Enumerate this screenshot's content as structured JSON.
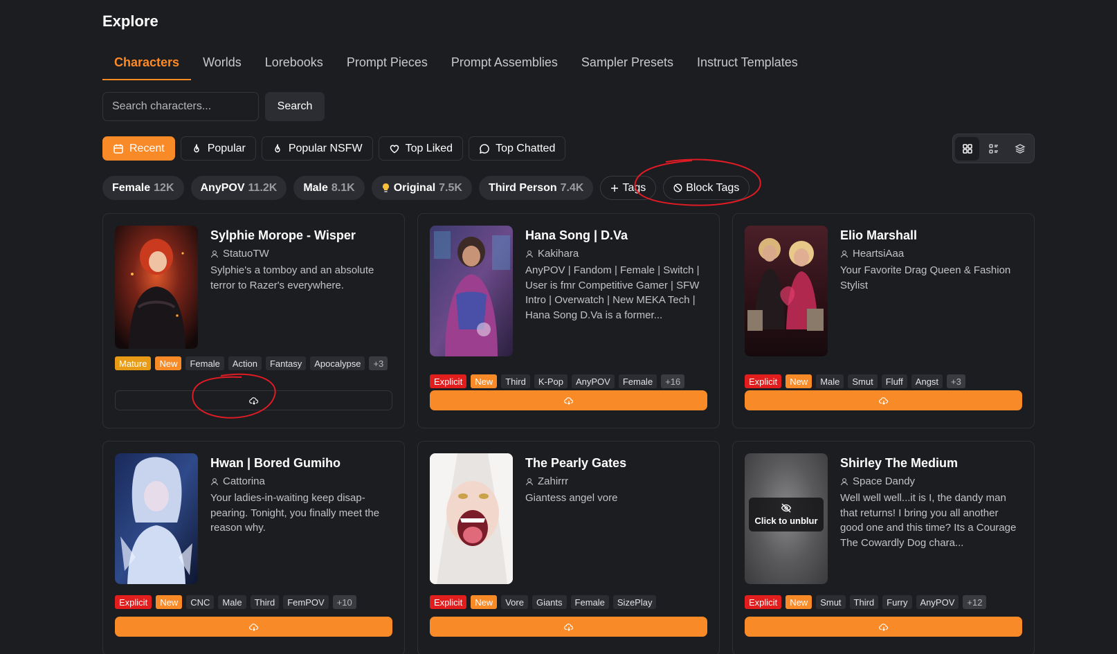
{
  "page": {
    "title": "Explore"
  },
  "tabs": [
    {
      "label": "Characters",
      "active": true
    },
    {
      "label": "Worlds"
    },
    {
      "label": "Lorebooks"
    },
    {
      "label": "Prompt Pieces"
    },
    {
      "label": "Prompt Assemblies"
    },
    {
      "label": "Sampler Presets"
    },
    {
      "label": "Instruct Templates"
    }
  ],
  "search": {
    "placeholder": "Search characters...",
    "value": "",
    "button_label": "Search"
  },
  "sorts": [
    {
      "label": "Recent",
      "icon": "calendar-icon",
      "active": true
    },
    {
      "label": "Popular",
      "icon": "flame-icon"
    },
    {
      "label": "Popular NSFW",
      "icon": "flame-icon"
    },
    {
      "label": "Top Liked",
      "icon": "heart-icon"
    },
    {
      "label": "Top Chatted",
      "icon": "chat-bubble-icon"
    }
  ],
  "views": [
    "grid-view-icon",
    "list-view-icon",
    "layers-view-icon"
  ],
  "tag_filters": [
    {
      "label": "Female",
      "count": "12K"
    },
    {
      "label": "AnyPOV",
      "count": "11.2K"
    },
    {
      "label": "Male",
      "count": "8.1K"
    },
    {
      "label": "Original",
      "count": "7.5K",
      "icon": "lightbulb-icon"
    },
    {
      "label": "Third Person",
      "count": "7.4K"
    }
  ],
  "tag_buttons": {
    "add_label": "Tags",
    "block_label": "Block Tags"
  },
  "colors": {
    "accent": "#f98a28",
    "background": "#1c1d21",
    "explicit": "#e11d1d",
    "mature": "#e89b16",
    "annotation": "#e01b24"
  },
  "cards": [
    {
      "name": "Sylphie Morope - Wisper",
      "author": "StatuoTW",
      "description": "Sylphie's a tomboy and an absolute terror to Razer's everywhere.",
      "tags": [
        {
          "label": "Mature",
          "kind": "mature"
        },
        {
          "label": "New",
          "kind": "new"
        },
        {
          "label": "Female"
        },
        {
          "label": "Action"
        },
        {
          "label": "Fantasy"
        },
        {
          "label": "Apocalypse"
        },
        {
          "label": "+3",
          "kind": "more"
        }
      ],
      "download_style": "ghost"
    },
    {
      "name": "Hana Song | D.Va",
      "author": "Kakihara",
      "description": "AnyPOV | Fandom | Female | Switch | User is fmr Competitive Gamer | SFW Intro | Overwatch | New MEKA Tech | Hana Song D.Va is a former...",
      "tags": [
        {
          "label": "Explicit",
          "kind": "explicit"
        },
        {
          "label": "New",
          "kind": "new"
        },
        {
          "label": "Third"
        },
        {
          "label": "K-Pop"
        },
        {
          "label": "AnyPOV"
        },
        {
          "label": "Female"
        },
        {
          "label": "+16",
          "kind": "more"
        }
      ]
    },
    {
      "name": "Elio Marshall",
      "author": "HeartsiAaa",
      "description": "Your Favorite Drag Queen & Fashion Stylist",
      "tags": [
        {
          "label": "Explicit",
          "kind": "explicit"
        },
        {
          "label": "New",
          "kind": "new"
        },
        {
          "label": "Male"
        },
        {
          "label": "Smut"
        },
        {
          "label": "Fluff"
        },
        {
          "label": "Angst"
        },
        {
          "label": "+3",
          "kind": "more"
        }
      ]
    },
    {
      "name": "Hwan | Bored Gumiho",
      "author": "Cattorina",
      "description": "Your ladies-in-waiting keep disap-pearing. Tonight, you finally meet the reason why.",
      "tags": [
        {
          "label": "Explicit",
          "kind": "explicit"
        },
        {
          "label": "New",
          "kind": "new"
        },
        {
          "label": "CNC"
        },
        {
          "label": "Male"
        },
        {
          "label": "Third"
        },
        {
          "label": "FemPOV"
        },
        {
          "label": "+10",
          "kind": "more"
        }
      ]
    },
    {
      "name": "The Pearly Gates",
      "author": "Zahirrr",
      "description": "Giantess angel vore",
      "tags": [
        {
          "label": "Explicit",
          "kind": "explicit"
        },
        {
          "label": "New",
          "kind": "new"
        },
        {
          "label": "Vore"
        },
        {
          "label": "Giants"
        },
        {
          "label": "Female"
        },
        {
          "label": "SizePlay"
        }
      ]
    },
    {
      "name": "Shirley The Medium",
      "author": "Space Dandy",
      "description": "Well well well...it is I, the dandy man that returns! I bring you all another good one and this time? Its a Courage The Cowardly Dog chara...",
      "blurred": true,
      "unblur_label": "Click to unblur",
      "tags": [
        {
          "label": "Explicit",
          "kind": "explicit"
        },
        {
          "label": "New",
          "kind": "new"
        },
        {
          "label": "Smut"
        },
        {
          "label": "Third"
        },
        {
          "label": "Furry"
        },
        {
          "label": "AnyPOV"
        },
        {
          "label": "+12",
          "kind": "more"
        }
      ]
    }
  ]
}
